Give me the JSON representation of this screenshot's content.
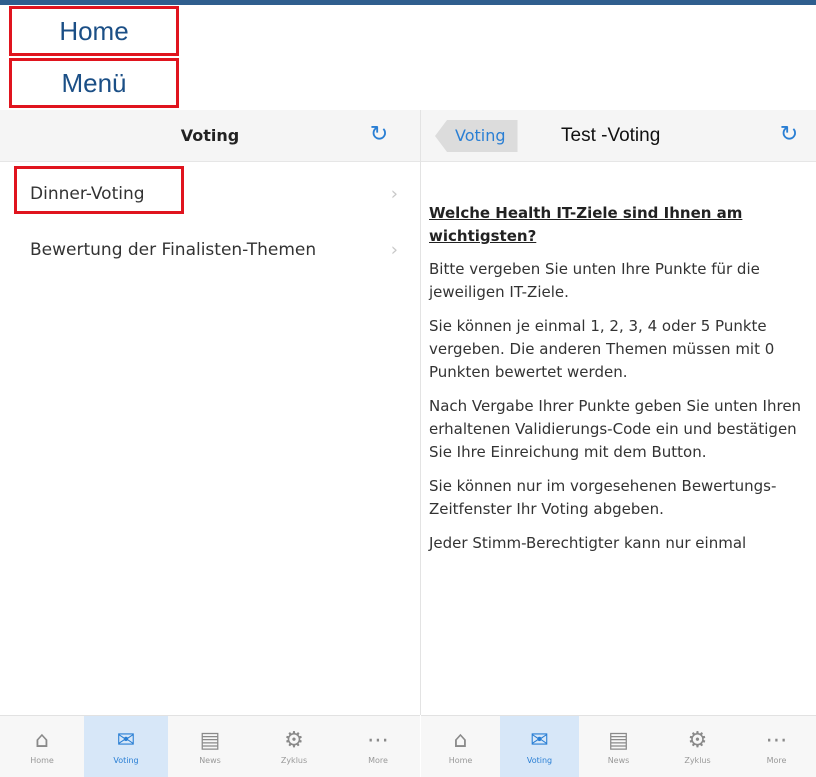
{
  "highlights": {
    "home": "Home",
    "menu": "Menü"
  },
  "left_panel": {
    "title": "Voting",
    "refresh_icon": "refresh-icon",
    "items": [
      {
        "label": "Dinner-Voting"
      },
      {
        "label": "Bewertung der Finalisten-Themen"
      }
    ]
  },
  "right_panel": {
    "back_label": "Voting",
    "title": "Test -Voting",
    "heading": "Welche Health IT-Ziele sind Ihnen am wichtigsten?",
    "paragraphs": [
      "Bitte vergeben Sie unten Ihre Punkte für die jeweiligen IT-Ziele.",
      "Sie können je einmal 1, 2, 3, 4 oder 5 Punkte vergeben. Die anderen Themen müssen mit 0 Punkten bewertet werden.",
      "Nach Vergabe Ihrer Punkte geben Sie unten Ihren erhaltenen Validierungs-Code ein und bestätigen Sie Ihre Einreichung mit dem Button.",
      "Sie können nur im vorgesehenen Bewertungs-Zeitfenster Ihr Voting abgeben.",
      "Jeder Stimm-Berechtigter kann nur einmal"
    ]
  },
  "tabbar": {
    "tabs": [
      {
        "label": "Home",
        "icon": "home-icon",
        "active": false
      },
      {
        "label": "Voting",
        "icon": "mail-icon",
        "active": true
      },
      {
        "label": "News",
        "icon": "news-icon",
        "active": false
      },
      {
        "label": "Zyklus",
        "icon": "gears-icon",
        "active": false
      },
      {
        "label": "More",
        "icon": "more-icon",
        "active": false
      }
    ]
  },
  "colors": {
    "accent": "#2a7fd4",
    "highlight_border": "#e0141e",
    "label_text": "#1b4f86"
  }
}
